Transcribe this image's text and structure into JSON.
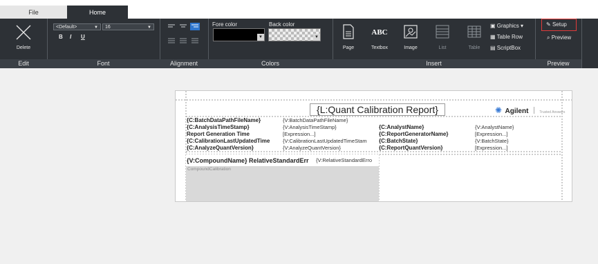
{
  "tabs": {
    "file": "File",
    "home": "Home"
  },
  "ribbon": {
    "edit": {
      "delete": "Delete",
      "group": "Edit"
    },
    "font": {
      "family": "<Default>",
      "size": "16",
      "bold": "B",
      "italic": "I",
      "underline": "U",
      "group": "Font"
    },
    "alignment": {
      "group": "Alignment"
    },
    "colors": {
      "fore_label": "Fore color",
      "back_label": "Back color",
      "group": "Colors"
    },
    "insert": {
      "page": "Page",
      "textbox": "Textbox",
      "image": "Image",
      "list": "List",
      "table": "Table",
      "graphics": "Graphics",
      "table_row": "Table Row",
      "scriptbox": "ScriptBox",
      "group": "Insert",
      "abc": "ABC"
    },
    "preview": {
      "setup": "Setup",
      "preview": "Preview",
      "group": "Preview"
    }
  },
  "report": {
    "title": "{L:Quant Calibration Report}",
    "logo": "Agilent",
    "tagline": "Trusted Answers",
    "rows": [
      {
        "l1": "{C:BatchDataPathFileName}",
        "v1": "{V:BatchDataPathFileName}",
        "l2": "",
        "v2": ""
      },
      {
        "l1": "{C:AnalysisTimeStamp}",
        "v1": "{V:AnalysisTimeStamp}",
        "l2": "{C:AnalystName}",
        "v2": "{V:AnalystName}"
      },
      {
        "l1": "Report Generation Time",
        "v1": "[Expression...]",
        "l2": "{C:ReportGeneratorName}",
        "v2": "[Expression...]"
      },
      {
        "l1": "{C:CalibrationLastUpdatedTime",
        "v1": "{V:CalibrationLastUpdatedTimeStam",
        "l2": "{C:BatchState}",
        "v2": "{V:BatchState}"
      },
      {
        "l1": "{C:AnalyzeQuantVersion}",
        "v1": "{V:AnalyzeQuantVersion}",
        "l2": "{C:ReportQuantVersion}",
        "v2": "[Expression...]"
      }
    ],
    "compound": {
      "label": "{V:CompoundName} RelativeStandardErr",
      "value": "{V:RelativeStandardErro",
      "sub": "CompoundCalibration"
    }
  }
}
